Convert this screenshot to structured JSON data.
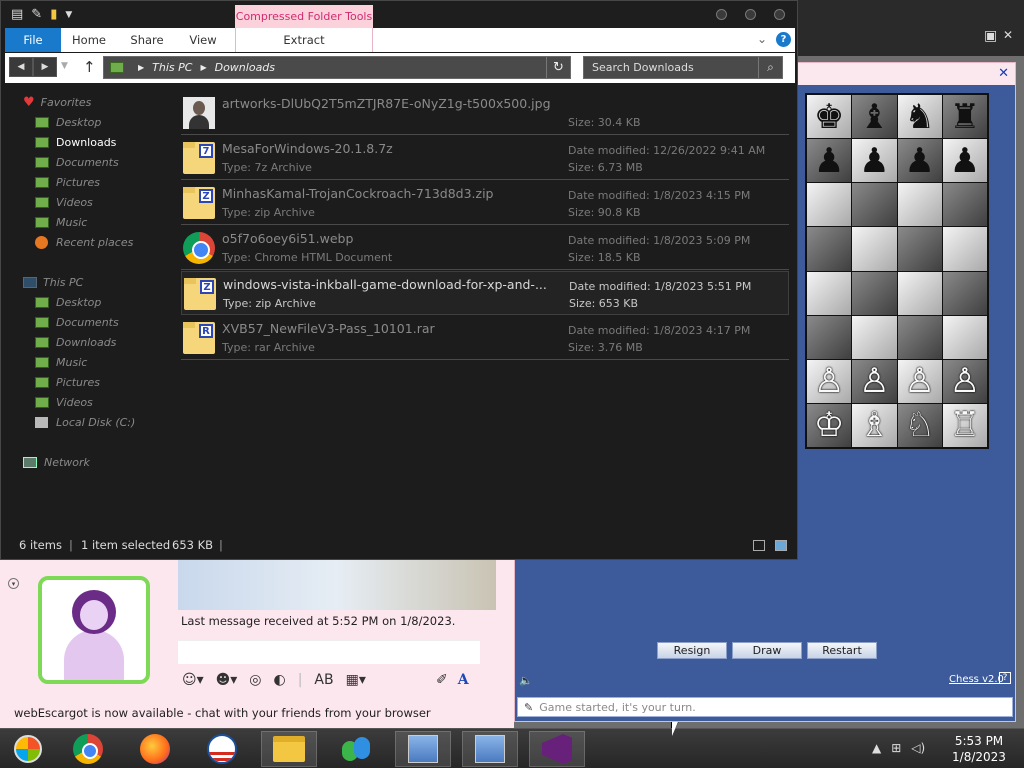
{
  "explorer": {
    "context_tab": "Compressed Folder Tools",
    "ribbon_tabs": {
      "file": "File",
      "home": "Home",
      "share": "Share",
      "view": "View",
      "extract": "Extract"
    },
    "address": {
      "root": "This PC",
      "folder": "Downloads"
    },
    "search_placeholder": "Search Downloads",
    "nav": {
      "favorites": "Favorites",
      "fav_items": [
        "Desktop",
        "Downloads",
        "Documents",
        "Pictures",
        "Videos",
        "Music",
        "Recent places"
      ],
      "this_pc": "This PC",
      "pc_items": [
        "Desktop",
        "Documents",
        "Downloads",
        "Music",
        "Pictures",
        "Videos",
        "Local Disk (C:)"
      ],
      "network": "Network"
    },
    "files": [
      {
        "name": "artworks-DlUbQ2T5mZTJR87E-oNyZ1g-t500x500.jpg",
        "type": "",
        "date": "",
        "size": "Size: 30.4 KB",
        "icon": "photo-thumbnail-icon"
      },
      {
        "name": "MesaForWindows-20.1.8.7z",
        "type": "Type: 7z Archive",
        "date": "Date modified: 12/26/2022 9:41 AM",
        "size": "Size: 6.73 MB",
        "icon": "7z-archive-icon",
        "badge": "7"
      },
      {
        "name": "MinhasKamal-TrojanCockroach-713d8d3.zip",
        "type": "Type: zip Archive",
        "date": "Date modified: 1/8/2023 4:15 PM",
        "size": "Size: 90.8 KB",
        "icon": "zip-archive-icon",
        "badge": "Z"
      },
      {
        "name": "o5f7o6oey6i51.webp",
        "type": "Type: Chrome HTML Document",
        "date": "Date modified: 1/8/2023 5:09 PM",
        "size": "Size: 18.5 KB",
        "icon": "chrome-document-icon"
      },
      {
        "name": "windows-vista-inkball-game-download-for-xp-and-...",
        "type": "Type: zip Archive",
        "date": "Date modified: 1/8/2023 5:51 PM",
        "size": "Size: 653 KB",
        "icon": "zip-archive-icon",
        "badge": "Z"
      },
      {
        "name": "XVB57_NewFileV3-Pass_10101.rar",
        "type": "Type: rar Archive",
        "date": "Date modified: 1/8/2023 4:17 PM",
        "size": "Size: 3.76 MB",
        "icon": "rar-archive-icon",
        "badge": "R"
      }
    ],
    "status": {
      "items": "6 items",
      "selected": "1 item selected",
      "selected_size": "653 KB"
    }
  },
  "chess": {
    "buttons": {
      "resign": "Resign",
      "draw": "Draw",
      "restart": "Restart"
    },
    "version": "Chess v2.0",
    "status": "Game started, it's your turn.",
    "board_rows": [
      [
        "♚",
        "♝",
        "♞",
        "♜"
      ],
      [
        "♟",
        "♟",
        "♟",
        "♟"
      ],
      [
        "",
        "",
        "",
        ""
      ],
      [
        "",
        "",
        "",
        ""
      ],
      [
        "",
        "",
        "",
        ""
      ],
      [
        "",
        "",
        "",
        ""
      ],
      [
        "♙",
        "♙",
        "♙",
        "♙"
      ],
      [
        "♔",
        "♗",
        "♘",
        "♖"
      ]
    ]
  },
  "messenger": {
    "last_message": "Last message received at 5:52 PM on 1/8/2023.",
    "escargot": "webEscargot is now available - chat with your friends from your browser"
  },
  "taskbar": {
    "time": "5:53 PM",
    "date": "1/8/2023"
  },
  "colors": {
    "accent": "#1979ca",
    "context_tab": "#d12a6f",
    "chess_bg": "#3d5a9a"
  }
}
